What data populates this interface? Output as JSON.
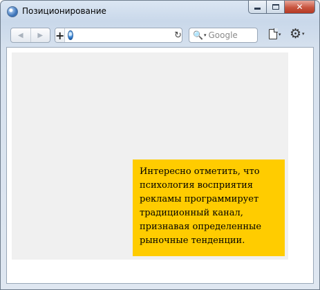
{
  "window": {
    "title": "Позиционирование",
    "icon": "browser-globe-icon",
    "controls": {
      "minimize": "minimize-icon",
      "maximize": "maximize-icon",
      "close": "close-icon",
      "close_glyph": "✕"
    }
  },
  "toolbar": {
    "back_glyph": "◀",
    "forward_glyph": "▶",
    "add_glyph": "+",
    "url_value": "",
    "reload_glyph": "↻",
    "search_placeholder": "Google",
    "search_glyph": "🔍",
    "page_menu_icon": "page-icon",
    "settings_icon": "gear-icon",
    "settings_glyph": "⚙",
    "caret_glyph": "▾"
  },
  "content": {
    "note_text": "Интересно отметить, что психология восприятия рекламы программирует традиционный канал, признавая определенные рыночные тенденции.",
    "note_color": "#ffcc00",
    "block_color": "#f0f0f0"
  }
}
